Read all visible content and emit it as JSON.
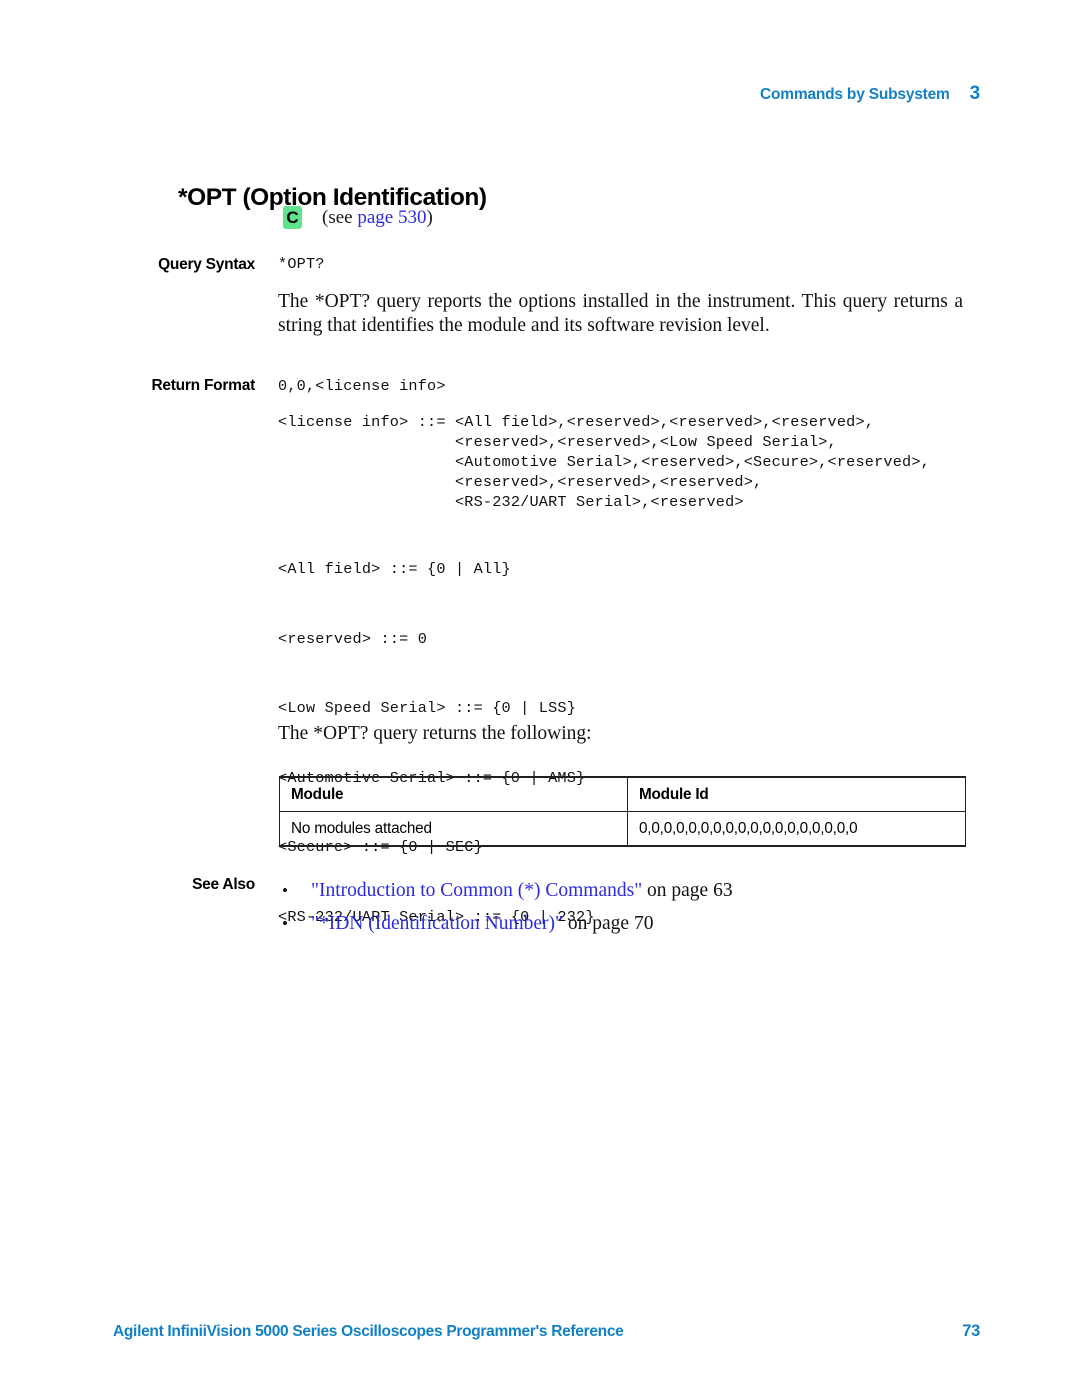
{
  "header": {
    "chapter_title": "Commands by Subsystem",
    "chapter_number": "3"
  },
  "command": {
    "title": "*OPT (Option Identification)",
    "badge": "C",
    "see_prefix": "(see ",
    "see_link": "page 530",
    "see_suffix": ")"
  },
  "labels": {
    "query_syntax": "Query Syntax",
    "return_format": "Return Format",
    "see_also": "See Also"
  },
  "query_syntax": {
    "code": "*OPT?"
  },
  "description": "The *OPT? query reports the options installed in the instrument. This query returns a string that identifies the module and its software revision level.",
  "return_format": {
    "code": "0,0,<license info>",
    "license_info_block": "<license info> ::= <All field>,<reserved>,<reserved>,<reserved>,\n                   <reserved>,<reserved>,<Low Speed Serial>,\n                   <Automotive Serial>,<reserved>,<Secure>,<reserved>,\n                   <reserved>,<reserved>,<reserved>,\n                   <RS-232/UART Serial>,<reserved>",
    "definitions": [
      "<All field> ::= {0 | All}",
      "<reserved> ::= 0",
      "<Low Speed Serial> ::= {0 | LSS}",
      "<Automotive Serial> ::= {0 | AMS}",
      "<Secure> ::= {0 | SEC}",
      "<RS-232/UART Serial> ::= {0 | 232}"
    ]
  },
  "returns_intro": "The *OPT? query returns the following:",
  "table": {
    "headers": [
      "Module",
      "Module Id"
    ],
    "rows": [
      [
        "No modules attached",
        "0,0,0,0,0,0,0,0,0,0,0,0,0,0,0,0,0,0"
      ]
    ]
  },
  "see_also_items": [
    {
      "link": "\"Introduction to Common (*) Commands\"",
      "tail": " on page 63"
    },
    {
      "link": "\"*IDN (Identification Number)\"",
      "tail": " on page 70"
    }
  ],
  "footer": {
    "title": "Agilent InfiniiVision 5000 Series Oscilloscopes Programmer's Reference",
    "page_number": "73"
  },
  "colors": {
    "accent_blue": "#1281C4",
    "link_blue": "#2B2BE0",
    "badge_green": "#5FE38C",
    "rule": "#231f20"
  }
}
